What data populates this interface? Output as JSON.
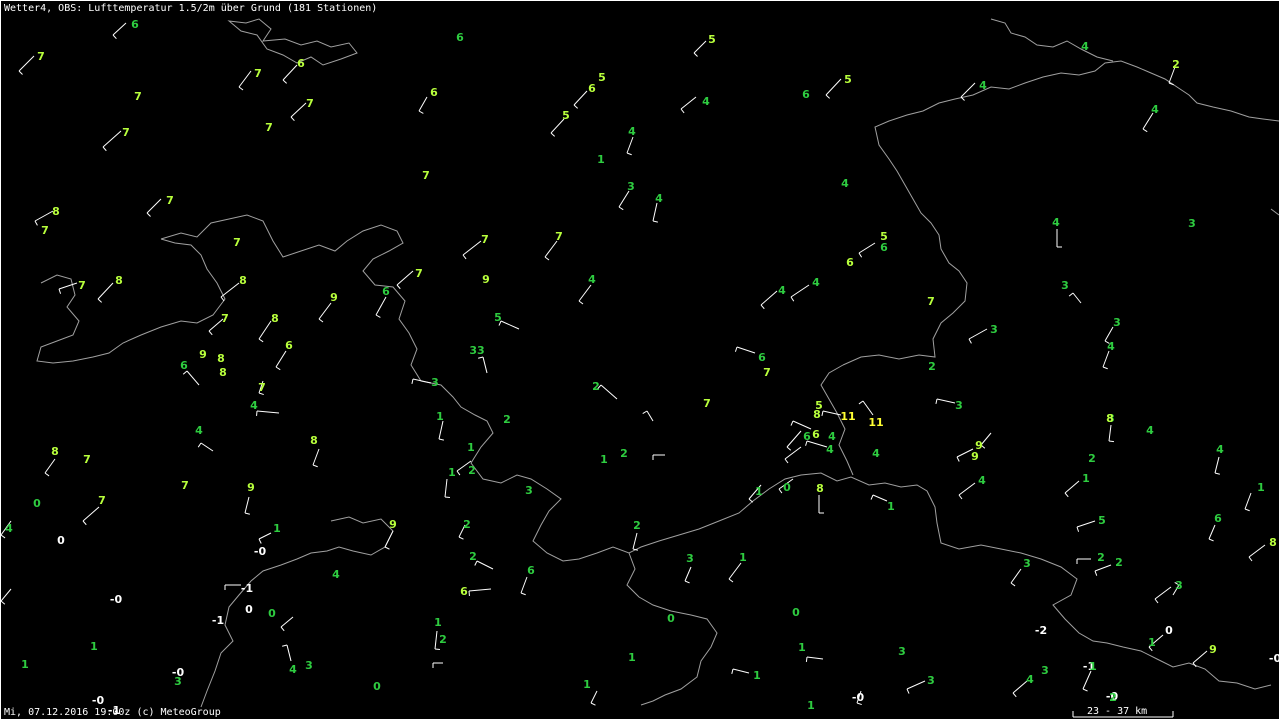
{
  "title": "Wetter4, OBS: Lufttemperatur 1.5/2m über Grund (181 Stationen)",
  "footer": "Mi, 07.12.2016 19:00z (c) MeteoGroup",
  "scale_label": "23 - 37 km",
  "colors": {
    "background": "#000000",
    "border_line": "#a0a0a0",
    "barb": "#ffffff",
    "temp_high": "#b8ff3c",
    "temp_mid": "#2ecc40",
    "temp_low": "#ffffff",
    "temp_max": "#ffff33"
  },
  "stations": [
    {
      "t": "6",
      "c": "mid"
    },
    {
      "t": "7",
      "c": "high"
    },
    {
      "t": "6",
      "c": "mid"
    },
    {
      "t": "5",
      "c": "high"
    },
    {
      "t": "7",
      "c": "high"
    },
    {
      "t": "6",
      "c": "high"
    },
    {
      "t": "7",
      "c": "high"
    },
    {
      "t": "7",
      "c": "high"
    },
    {
      "t": "6",
      "c": "high"
    },
    {
      "t": "5",
      "c": "high"
    },
    {
      "t": "6",
      "c": "high"
    },
    {
      "t": "5",
      "c": "high"
    },
    {
      "t": "4",
      "c": "mid"
    },
    {
      "t": "6",
      "c": "mid"
    },
    {
      "t": "5",
      "c": "high"
    },
    {
      "t": "7",
      "c": "high"
    },
    {
      "t": "7",
      "c": "high"
    },
    {
      "t": "4",
      "c": "mid"
    },
    {
      "t": "1",
      "c": "mid"
    },
    {
      "t": "4",
      "c": "mid"
    },
    {
      "t": "7",
      "c": "high"
    },
    {
      "t": "3",
      "c": "mid"
    },
    {
      "t": "4",
      "c": "mid"
    },
    {
      "t": "4",
      "c": "mid"
    },
    {
      "t": "8",
      "c": "high"
    },
    {
      "t": "7",
      "c": "high"
    },
    {
      "t": "7",
      "c": "high"
    },
    {
      "t": "7",
      "c": "high"
    },
    {
      "t": "7",
      "c": "high"
    },
    {
      "t": "7",
      "c": "high"
    },
    {
      "t": "5",
      "c": "high"
    },
    {
      "t": "6",
      "c": "high"
    },
    {
      "t": "6",
      "c": "mid"
    },
    {
      "t": "4",
      "c": "mid"
    },
    {
      "t": "3",
      "c": "mid"
    },
    {
      "t": "4",
      "c": "mid"
    },
    {
      "t": "2",
      "c": "high"
    },
    {
      "t": "4",
      "c": "mid"
    },
    {
      "t": "4",
      "c": "mid"
    },
    {
      "t": "7",
      "c": "high"
    },
    {
      "t": "8",
      "c": "high"
    },
    {
      "t": "8",
      "c": "high"
    },
    {
      "t": "7",
      "c": "high"
    },
    {
      "t": "9",
      "c": "high"
    },
    {
      "t": "6",
      "c": "mid"
    },
    {
      "t": "7",
      "c": "high"
    },
    {
      "t": "9",
      "c": "high"
    },
    {
      "t": "4",
      "c": "mid"
    },
    {
      "t": "4",
      "c": "mid"
    },
    {
      "t": "5",
      "c": "mid"
    },
    {
      "t": "3",
      "c": "mid"
    },
    {
      "t": "7",
      "c": "high"
    },
    {
      "t": "3",
      "c": "mid"
    },
    {
      "t": "3",
      "c": "mid"
    },
    {
      "t": "4",
      "c": "mid"
    },
    {
      "t": "7",
      "c": "high"
    },
    {
      "t": "8",
      "c": "high"
    },
    {
      "t": "6",
      "c": "high"
    },
    {
      "t": "9",
      "c": "high"
    },
    {
      "t": "8",
      "c": "high"
    },
    {
      "t": "8",
      "c": "high"
    },
    {
      "t": "3",
      "c": "mid"
    },
    {
      "t": "33",
      "c": "mid"
    },
    {
      "t": "2",
      "c": "mid"
    },
    {
      "t": "6",
      "c": "mid"
    },
    {
      "t": "7",
      "c": "high"
    },
    {
      "t": "2",
      "c": "mid"
    },
    {
      "t": "7",
      "c": "high"
    },
    {
      "t": "4",
      "c": "mid"
    },
    {
      "t": "3",
      "c": "mid"
    },
    {
      "t": "1",
      "c": "mid"
    },
    {
      "t": "2",
      "c": "mid"
    },
    {
      "t": "5",
      "c": "high"
    },
    {
      "t": "8",
      "c": "high"
    },
    {
      "t": "6",
      "c": "high"
    },
    {
      "t": "11",
      "c": "max"
    },
    {
      "t": "11",
      "c": "max"
    },
    {
      "t": "3",
      "c": "mid"
    },
    {
      "t": "6",
      "c": "mid"
    },
    {
      "t": "4",
      "c": "mid"
    },
    {
      "t": "4",
      "c": "mid"
    },
    {
      "t": "4",
      "c": "mid"
    },
    {
      "t": "9",
      "c": "high"
    },
    {
      "t": "9",
      "c": "high"
    },
    {
      "t": "6",
      "c": "mid"
    },
    {
      "t": "4",
      "c": "mid"
    },
    {
      "t": "4",
      "c": "mid"
    },
    {
      "t": "4",
      "c": "mid"
    },
    {
      "t": "8",
      "c": "high"
    },
    {
      "t": "7",
      "c": "high"
    },
    {
      "t": "4",
      "c": "mid"
    },
    {
      "t": "8",
      "c": "high"
    },
    {
      "t": "7",
      "c": "high"
    },
    {
      "t": "9",
      "c": "high"
    },
    {
      "t": "1",
      "c": "mid"
    },
    {
      "t": "1",
      "c": "mid"
    },
    {
      "t": "2",
      "c": "mid"
    },
    {
      "t": "1",
      "c": "mid"
    },
    {
      "t": "2",
      "c": "mid"
    },
    {
      "t": "1",
      "c": "mid"
    },
    {
      "t": "2",
      "c": "mid"
    },
    {
      "t": "1",
      "c": "mid"
    },
    {
      "t": "0",
      "c": "mid"
    },
    {
      "t": "1",
      "c": "mid"
    },
    {
      "t": "1",
      "c": "mid"
    },
    {
      "t": "4",
      "c": "mid"
    },
    {
      "t": "5",
      "c": "mid"
    },
    {
      "t": "6",
      "c": "mid"
    },
    {
      "t": "3",
      "c": "mid"
    },
    {
      "t": "8",
      "c": "high"
    },
    {
      "t": "9",
      "c": "high"
    },
    {
      "t": "8",
      "c": "high"
    },
    {
      "t": "8",
      "c": "high"
    },
    {
      "t": "7",
      "c": "high"
    },
    {
      "t": "0",
      "c": "mid"
    },
    {
      "t": "1",
      "c": "mid"
    },
    {
      "t": "-0",
      "c": "low"
    },
    {
      "t": "0",
      "c": "low"
    },
    {
      "t": "2",
      "c": "mid"
    },
    {
      "t": "2",
      "c": "mid"
    },
    {
      "t": "2",
      "c": "mid"
    },
    {
      "t": "2",
      "c": "mid"
    },
    {
      "t": "3",
      "c": "mid"
    },
    {
      "t": "1",
      "c": "mid"
    },
    {
      "t": "3",
      "c": "mid"
    },
    {
      "t": "3",
      "c": "mid"
    },
    {
      "t": "2",
      "c": "mid"
    },
    {
      "t": "2",
      "c": "mid"
    },
    {
      "t": "4",
      "c": "mid"
    },
    {
      "t": "3",
      "c": "mid"
    },
    {
      "t": "9",
      "c": "high"
    },
    {
      "t": "0",
      "c": "low"
    },
    {
      "t": "-1",
      "c": "low"
    },
    {
      "t": "4",
      "c": "mid"
    },
    {
      "t": "6",
      "c": "high"
    },
    {
      "t": "6",
      "c": "mid"
    },
    {
      "t": "-1",
      "c": "low"
    },
    {
      "t": "0",
      "c": "low"
    },
    {
      "t": "0",
      "c": "mid"
    },
    {
      "t": "1",
      "c": "mid"
    },
    {
      "t": "1",
      "c": "mid"
    },
    {
      "t": "1",
      "c": "mid"
    },
    {
      "t": "-0",
      "c": "low"
    },
    {
      "t": "-0",
      "c": "low"
    },
    {
      "t": "-0",
      "c": "low"
    },
    {
      "t": "3",
      "c": "mid"
    },
    {
      "t": "4",
      "c": "mid"
    },
    {
      "t": "3",
      "c": "mid"
    },
    {
      "t": "0",
      "c": "mid"
    },
    {
      "t": "1",
      "c": "mid"
    },
    {
      "t": "-0",
      "c": "low"
    },
    {
      "t": "-1",
      "c": "low"
    },
    {
      "t": "-2",
      "c": "low"
    },
    {
      "t": "-0",
      "c": "low"
    },
    {
      "t": "-1",
      "c": "low"
    },
    {
      "t": "1",
      "c": "mid"
    },
    {
      "t": "-0",
      "c": "low"
    },
    {
      "t": "1",
      "c": "mid"
    },
    {
      "t": "1",
      "c": "mid"
    },
    {
      "t": "0",
      "c": "mid"
    },
    {
      "t": "2",
      "c": "mid"
    },
    {
      "t": "1",
      "c": "mid"
    },
    {
      "t": "1",
      "c": "mid"
    },
    {
      "t": "3",
      "c": "mid"
    },
    {
      "t": "3",
      "c": "mid"
    },
    {
      "t": "1",
      "c": "mid"
    },
    {
      "t": "0",
      "c": "mid"
    }
  ]
}
